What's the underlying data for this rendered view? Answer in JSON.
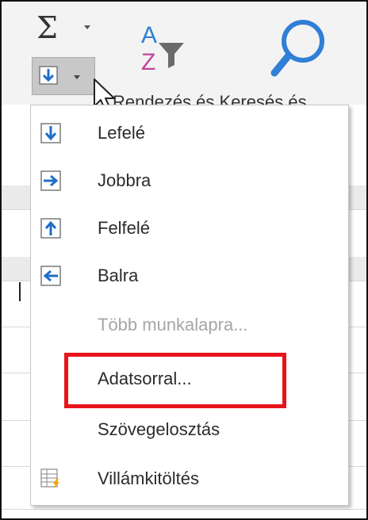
{
  "ribbon": {
    "sigma_glyph": "Σ",
    "group_label": "Rendezés és Keresés és"
  },
  "menu": {
    "items": [
      {
        "label": "Lefelé",
        "icon": "fill-down-icon",
        "enabled": true
      },
      {
        "label": "Jobbra",
        "icon": "fill-right-icon",
        "enabled": true
      },
      {
        "label": "Felfelé",
        "icon": "fill-up-icon",
        "enabled": true
      },
      {
        "label": "Balra",
        "icon": "fill-left-icon",
        "enabled": true
      },
      {
        "label": "Több munkalapra...",
        "icon": "",
        "enabled": false
      },
      {
        "label": "Adatsorral...",
        "icon": "",
        "enabled": true,
        "highlighted": true
      },
      {
        "label": "Szövegelosztás",
        "icon": "",
        "enabled": true
      },
      {
        "label": "Villámkitöltés",
        "icon": "flash-fill-icon",
        "enabled": true
      }
    ]
  },
  "colors": {
    "arrow_blue": "#1f6fc9",
    "highlight": "#e8141b",
    "disabled_text": "#a6a6a6"
  }
}
